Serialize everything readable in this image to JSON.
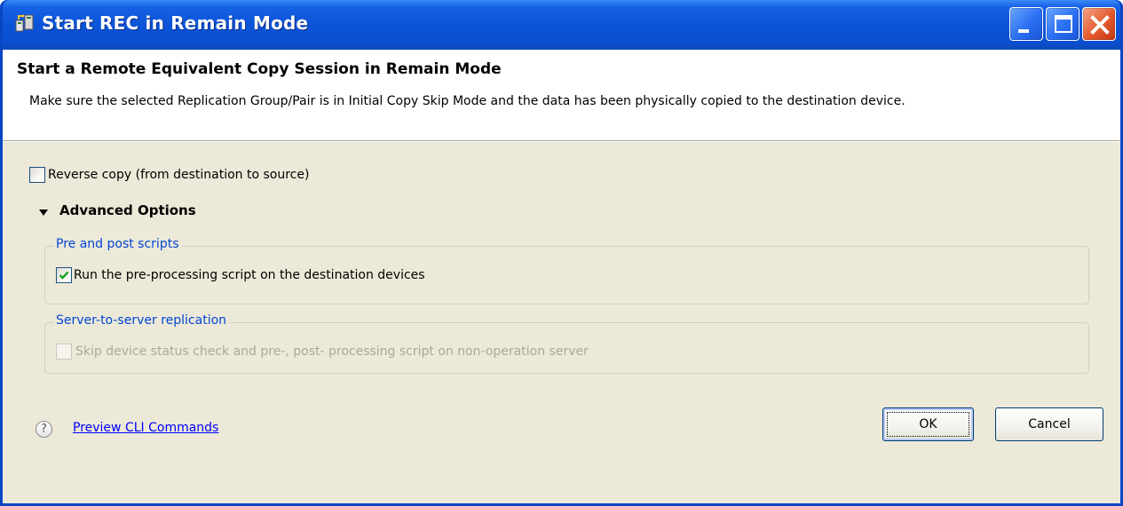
{
  "window": {
    "title": "Start REC in Remain Mode",
    "title_color": "#ffffff",
    "titlebar_color": "#0a4fd0"
  },
  "header": {
    "title": "Start a Remote Equivalent Copy Session in Remain Mode",
    "description": "Make sure the selected Replication Group/Pair is in Initial Copy Skip Mode and the data has been physically copied to the destination device."
  },
  "options": {
    "reverse_copy": {
      "label": "Reverse copy (from destination to source)",
      "checked": false
    },
    "advanced_label": "Advanced Options",
    "groups": [
      {
        "title": "Pre and post scripts",
        "option": {
          "label": "Run the pre-processing script on the destination devices",
          "checked": true,
          "enabled": true
        }
      },
      {
        "title": "Server-to-server replication",
        "option": {
          "label": "Skip device status check and pre-, post- processing script on non-operation server",
          "checked": false,
          "enabled": false
        }
      }
    ]
  },
  "footer": {
    "help_glyph": "?",
    "preview_link": "Preview CLI Commands",
    "ok_label": "OK",
    "cancel_label": "Cancel",
    "link_color": "#0000ff",
    "group_title_color": "#0046d5"
  }
}
